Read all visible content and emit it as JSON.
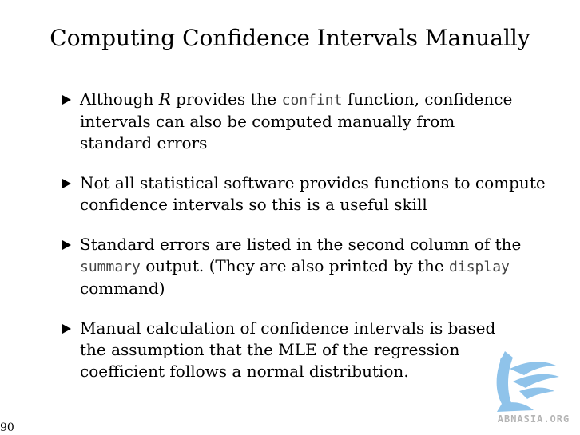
{
  "slide": {
    "title": "Computing Confidence Intervals Manually",
    "page_number": "90"
  },
  "bullets": [
    {
      "a": "Although ",
      "b": "R",
      "c": " provides the ",
      "d": "confint",
      "e": " function, confidence intervals can also be computed manually from standard errors"
    },
    {
      "a": "Not all statistical software provides functions to compute confidence intervals so this is a useful skill"
    },
    {
      "a": "Standard errors are listed in the second column of the ",
      "b": "summary",
      "c": " output. (They are also printed by the ",
      "d": "display",
      "e": " command)"
    },
    {
      "a": "Manual calculation of confidence intervals is based the assumption that the MLE of the regression coefficient follows a normal distribution."
    }
  ],
  "logo": {
    "text": "ABNASIA.ORG",
    "color": "#8fc3ea"
  }
}
